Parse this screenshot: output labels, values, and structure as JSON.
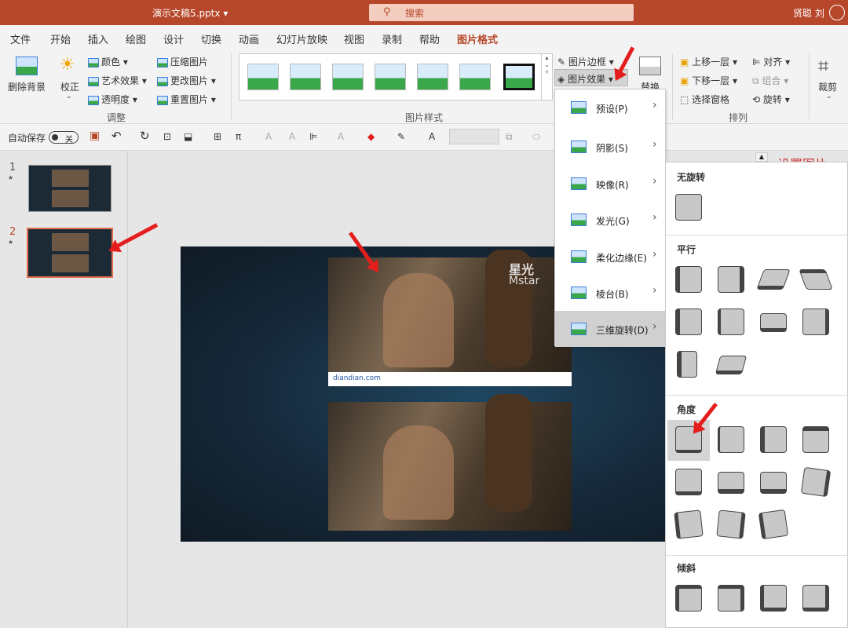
{
  "title_bar": {
    "doc_name": "演示文稿5.pptx",
    "doc_caret": "▾",
    "search_placeholder": "搜索",
    "user": "贤聪 刘"
  },
  "tabs": [
    {
      "label": "文件"
    },
    {
      "label": "开始"
    },
    {
      "label": "插入"
    },
    {
      "label": "绘图"
    },
    {
      "label": "设计"
    },
    {
      "label": "切换"
    },
    {
      "label": "动画"
    },
    {
      "label": "幻灯片放映"
    },
    {
      "label": "视图"
    },
    {
      "label": "录制"
    },
    {
      "label": "帮助"
    },
    {
      "label": "图片格式"
    }
  ],
  "ribbon": {
    "remove_bg": "删除背景",
    "correct": "校正",
    "color": "颜色",
    "art_effects": "艺术效果",
    "transparency": "透明度",
    "compress": "压缩图片",
    "change": "更改图片",
    "reset": "重置图片",
    "group_adjust": "调整",
    "group_styles": "图片样式",
    "border": "图片边框",
    "effects": "图片效果",
    "replace": "替换",
    "bring_forward": "上移一层",
    "send_backward": "下移一层",
    "selection_pane": "选择窗格",
    "align": "对齐",
    "group_btn": "组合",
    "rotate": "旋转",
    "group_arrange": "排列",
    "crop": "裁剪",
    "caret": "▾"
  },
  "qat": {
    "autosave": "自动保存",
    "toggle": "关"
  },
  "slides": [
    {
      "num": "1"
    },
    {
      "num": "2"
    }
  ],
  "slide_star": "★",
  "watermark": "diandian.com",
  "logo_text": "星光",
  "logo_sub": "Mstar",
  "effects_menu": [
    {
      "label": "预设(P)"
    },
    {
      "label": "阴影(S)"
    },
    {
      "label": "映像(R)"
    },
    {
      "label": "发光(G)"
    },
    {
      "label": "柔化边缘(E)"
    },
    {
      "label": "棱台(B)"
    },
    {
      "label": "三维旋转(D)"
    }
  ],
  "menu_arrow": "›",
  "rotation_submenu": {
    "no_rotation": "无旋转",
    "parallel": "平行",
    "perspective": "角度",
    "oblique": "倾斜"
  },
  "truncated_text": "设置图片",
  "colors": {
    "accent": "#b7472a",
    "arrow": "#e41d1d"
  }
}
